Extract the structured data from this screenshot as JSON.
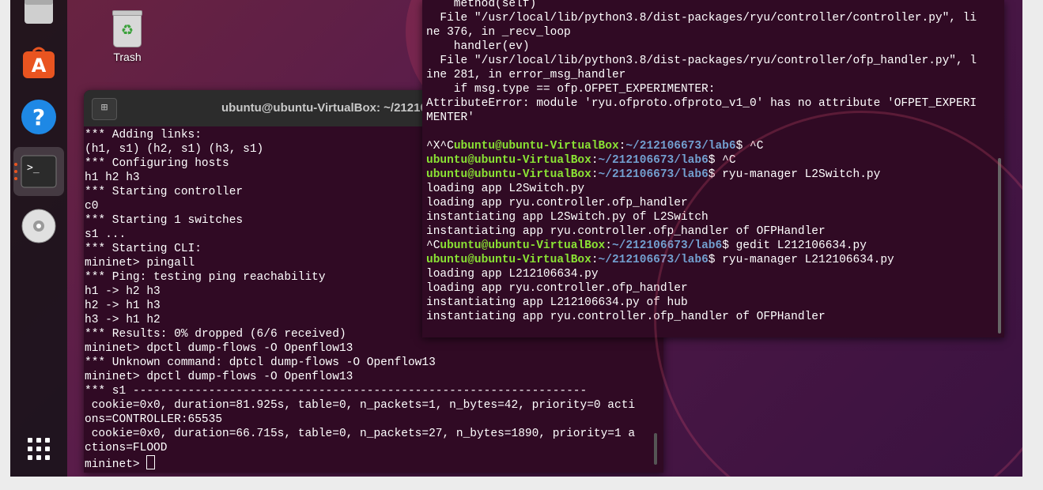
{
  "desktop": {
    "trash_label": "Trash"
  },
  "dock": {
    "items": [
      "files-icon",
      "software-icon",
      "help-icon",
      "terminal-icon",
      "disc-icon",
      "apps-grid-icon"
    ]
  },
  "terminal_left": {
    "title": "ubuntu@ubuntu-VirtualBox: ~/212106673/lab6",
    "lines": [
      "*** Adding links:",
      "(h1, s1) (h2, s1) (h3, s1)",
      "*** Configuring hosts",
      "h1 h2 h3",
      "*** Starting controller",
      "c0",
      "*** Starting 1 switches",
      "s1 ...",
      "*** Starting CLI:",
      "mininet> pingall",
      "*** Ping: testing ping reachability",
      "h1 -> h2 h3",
      "h2 -> h1 h3",
      "h3 -> h1 h2",
      "*** Results: 0% dropped (6/6 received)",
      "mininet> dpctl dump-flows -O Openflow13",
      "*** Unknown command: dptcl dump-flows -O Openflow13",
      "mininet> dpctl dump-flows -O Openflow13",
      "*** s1 ------------------------------------------------------------------",
      " cookie=0x0, duration=81.925s, table=0, n_packets=1, n_bytes=42, priority=0 acti",
      "ons=CONTROLLER:65535",
      " cookie=0x0, duration=66.715s, table=0, n_packets=27, n_bytes=1890, priority=1 a",
      "ctions=FLOOD"
    ],
    "prompt": "mininet> "
  },
  "terminal_right": {
    "traceback_lines": [
      "    method(self)",
      "  File \"/usr/local/lib/python3.8/dist-packages/ryu/controller/controller.py\", li",
      "ne 376, in _recv_loop",
      "    handler(ev)",
      "  File \"/usr/local/lib/python3.8/dist-packages/ryu/controller/ofp_handler.py\", l",
      "ine 281, in error_msg_handler",
      "    if msg.type == ofp.OFPET_EXPERIMENTER:",
      "AttributeError: module 'ryu.ofproto.ofproto_v1_0' has no attribute 'OFPET_EXPERI",
      "MENTER'",
      ""
    ],
    "user_host": "ubuntu@ubuntu-VirtualBox",
    "path": "~/212106673/lab6",
    "session": [
      {
        "prefix": "^X^C",
        "cmd": " ^C"
      },
      {
        "prefix": "",
        "cmd": " ^C"
      },
      {
        "prefix": "",
        "cmd": " ryu-manager L2Switch.py"
      },
      {
        "output": "loading app L2Switch.py"
      },
      {
        "output": "loading app ryu.controller.ofp_handler"
      },
      {
        "output": "instantiating app L2Switch.py of L2Switch"
      },
      {
        "output": "instantiating app ryu.controller.ofp_handler of OFPHandler"
      },
      {
        "prefix": "^C",
        "cmd": " gedit L212106634.py"
      },
      {
        "prefix": "",
        "cmd": " ryu-manager L212106634.py"
      },
      {
        "output": "loading app L212106634.py"
      },
      {
        "output": "loading app ryu.controller.ofp_handler"
      },
      {
        "output": "instantiating app L212106634.py of hub"
      },
      {
        "output": "instantiating app ryu.controller.ofp_handler of OFPHandler"
      }
    ]
  }
}
